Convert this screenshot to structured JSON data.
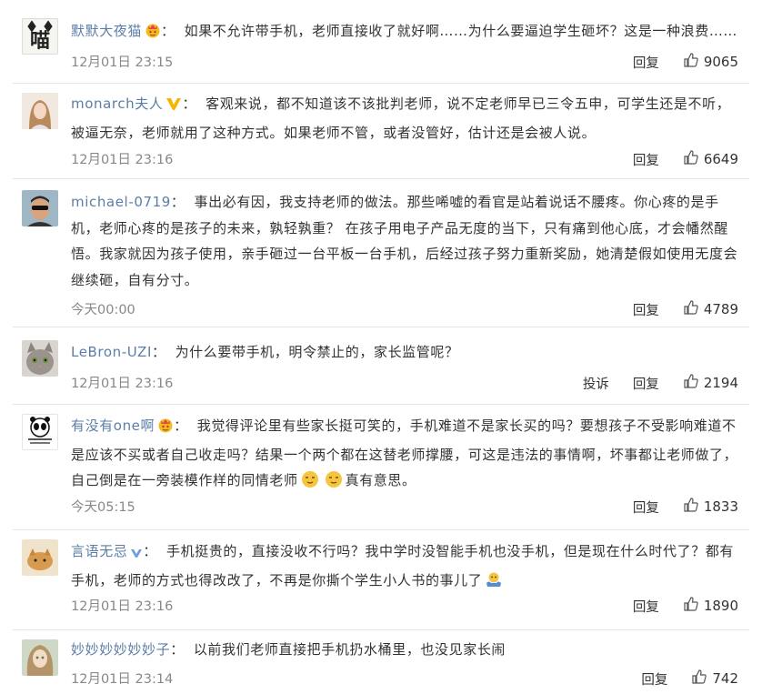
{
  "comments": [
    {
      "username": "默默大夜猫",
      "badge": "crown-emoji",
      "avatar_text": "喵",
      "text": "如果不允许带手机，老师直接收了就好啊……为什么要逼迫学生砸坏？这是一种浪费……",
      "time": "12月01日 23:15",
      "reply_label": "回复",
      "report_label": "",
      "likes": "9065"
    },
    {
      "username": "monarch夫人",
      "badge": "gold-v-badge",
      "avatar_text": "",
      "text": "客观来说，都不知道该不该批判老师，说不定老师早已三令五申，可学生还是不听，被逼无奈，老师就用了这种方式。如果老师不管，或者没管好，估计还是会被人说。",
      "time": "12月01日 23:16",
      "reply_label": "回复",
      "report_label": "",
      "likes": "6649"
    },
    {
      "username": "michael-0719",
      "badge": "",
      "avatar_text": "",
      "text": "事出必有因，我支持老师的做法。那些唏嘘的看官是站着说话不腰疼。你心疼的是手机，老师心疼的是孩子的未来，孰轻孰重？ 在孩子用电子产品无度的当下，只有痛到他心底，才会幡然醒悟。我家就因为孩子使用，亲手砸过一台平板一台手机，后经过孩子努力重新奖励，她清楚假如使用无度会继续砸，自有分寸。",
      "time": "今天00:00",
      "reply_label": "回复",
      "report_label": "",
      "likes": "4789"
    },
    {
      "username": "LeBron-UZI",
      "badge": "",
      "avatar_text": "",
      "text": "为什么要带手机，明令禁止的，家长监管呢？",
      "time": "12月01日 23:16",
      "reply_label": "回复",
      "report_label": "投诉",
      "likes": "2194"
    },
    {
      "username": "有没有one啊",
      "badge": "crown-emoji",
      "avatar_text": "",
      "text": "我觉得评论里有些家长挺可笑的，手机难道不是家长买的吗？要想孩子不受影响难道不是应该不买或者自己收走吗？结果一个两个都在这替老师撑腰，可这是违法的事情啊，坏事都让老师做了，自己倒是在一旁装模作样的同情老师",
      "text_tail": "真有意思。",
      "time": "今天05:15",
      "reply_label": "回复",
      "report_label": "",
      "likes": "1833"
    },
    {
      "username": "言语无忌",
      "badge": "small-v-badge",
      "avatar_text": "",
      "text": "手机挺贵的，直接没收不行吗？我中学时没智能手机也没手机，但是现在什么时代了？都有手机，老师的方式也得改改了，不再是你撕个学生小人书的事儿了",
      "time": "12月01日 23:16",
      "reply_label": "回复",
      "report_label": "",
      "likes": "1890"
    },
    {
      "username": "妙妙妙妙妙妙子",
      "badge": "",
      "avatar_text": "",
      "text": "以前我们老师直接把手机扔水桶里，也没见家长闹",
      "time": "12月01日 23:14",
      "reply_label": "回复",
      "report_label": "",
      "likes": "742"
    }
  ],
  "colors": {
    "username": "#5b7ea8",
    "meta": "#888888",
    "divider": "#e6e6e6"
  }
}
